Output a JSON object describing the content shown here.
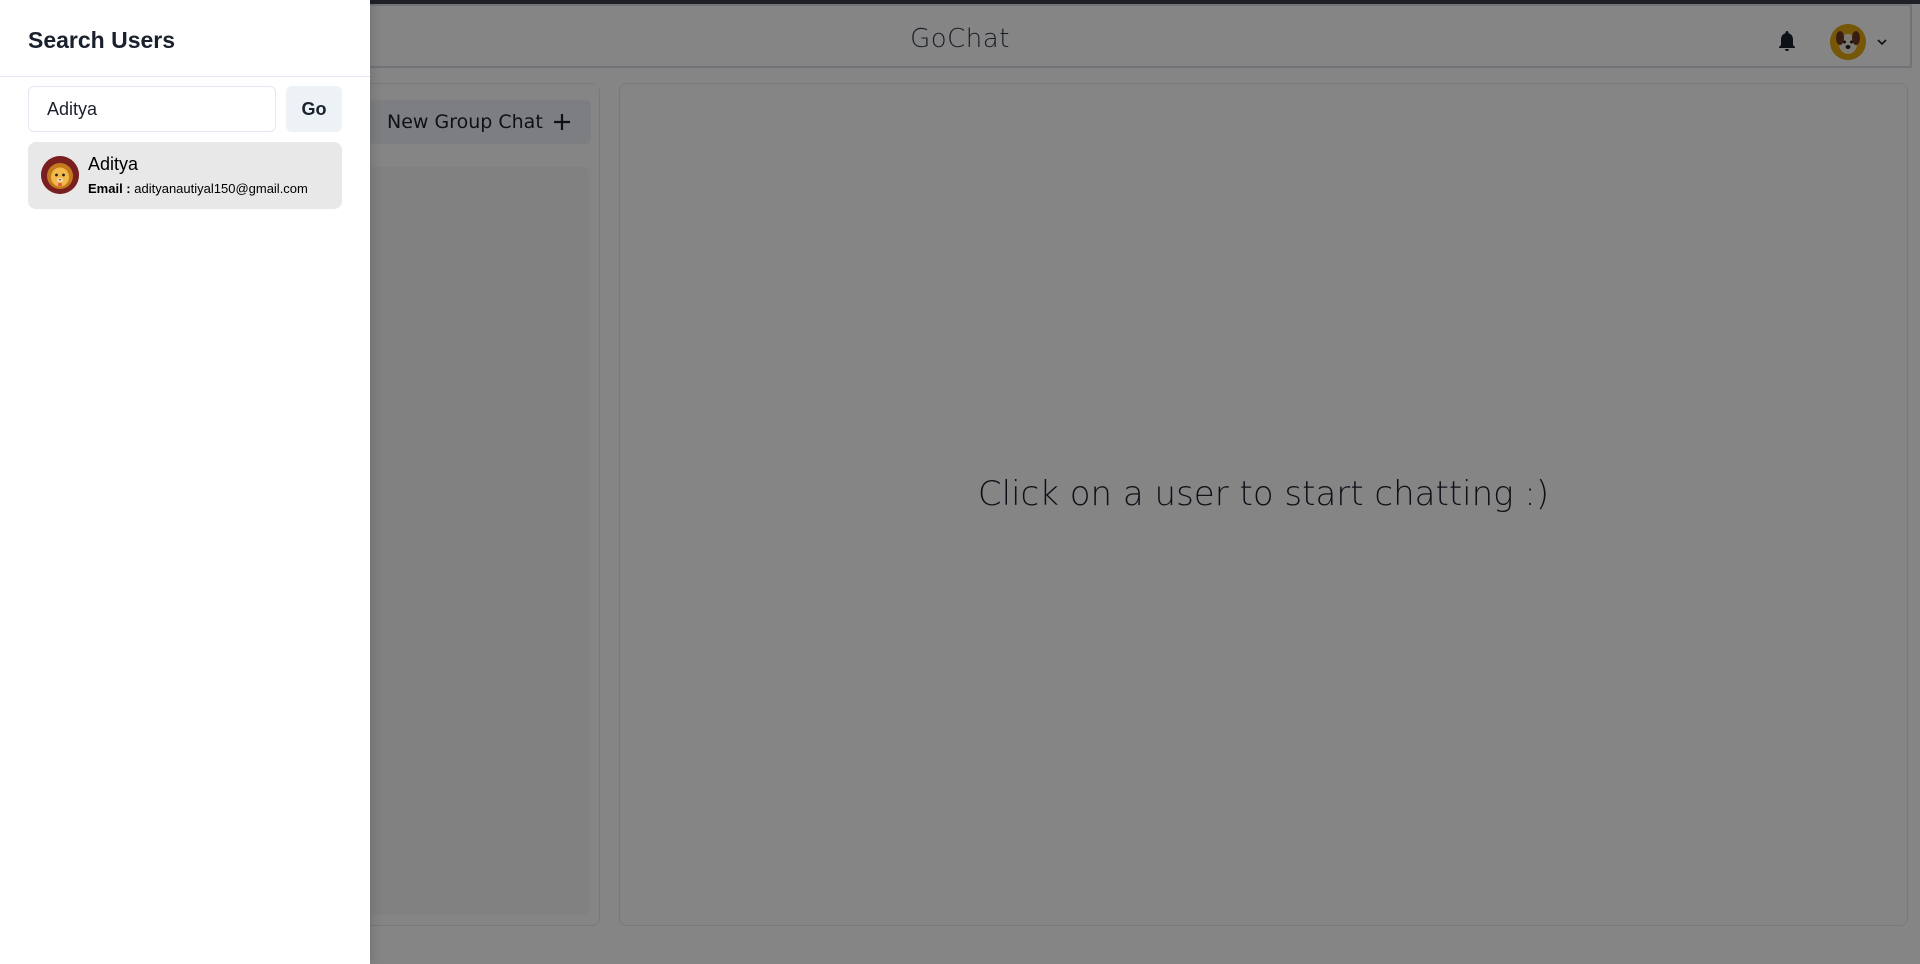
{
  "app": {
    "title": "GoChat"
  },
  "header": {
    "notification_icon": "bell-icon",
    "avatar_icon": "dog-avatar",
    "menu_icon": "chevron-down-icon"
  },
  "sidebar": {
    "new_group_label": "New Group Chat",
    "new_group_icon": "plus-icon"
  },
  "chat": {
    "placeholder": "Click on a user to start chatting :)"
  },
  "drawer": {
    "title": "Search Users",
    "search_value": "Aditya",
    "go_label": "Go",
    "results": [
      {
        "name": "Aditya",
        "email_label": "Email :",
        "email": "adityanautiyal150@gmail.com",
        "avatar_icon": "lion-avatar"
      }
    ]
  },
  "colors": {
    "overlay": "#000000",
    "avatar_bg": "#e2a50f",
    "result_bg": "#e8e8e8",
    "button_bg": "#edf2f7"
  }
}
